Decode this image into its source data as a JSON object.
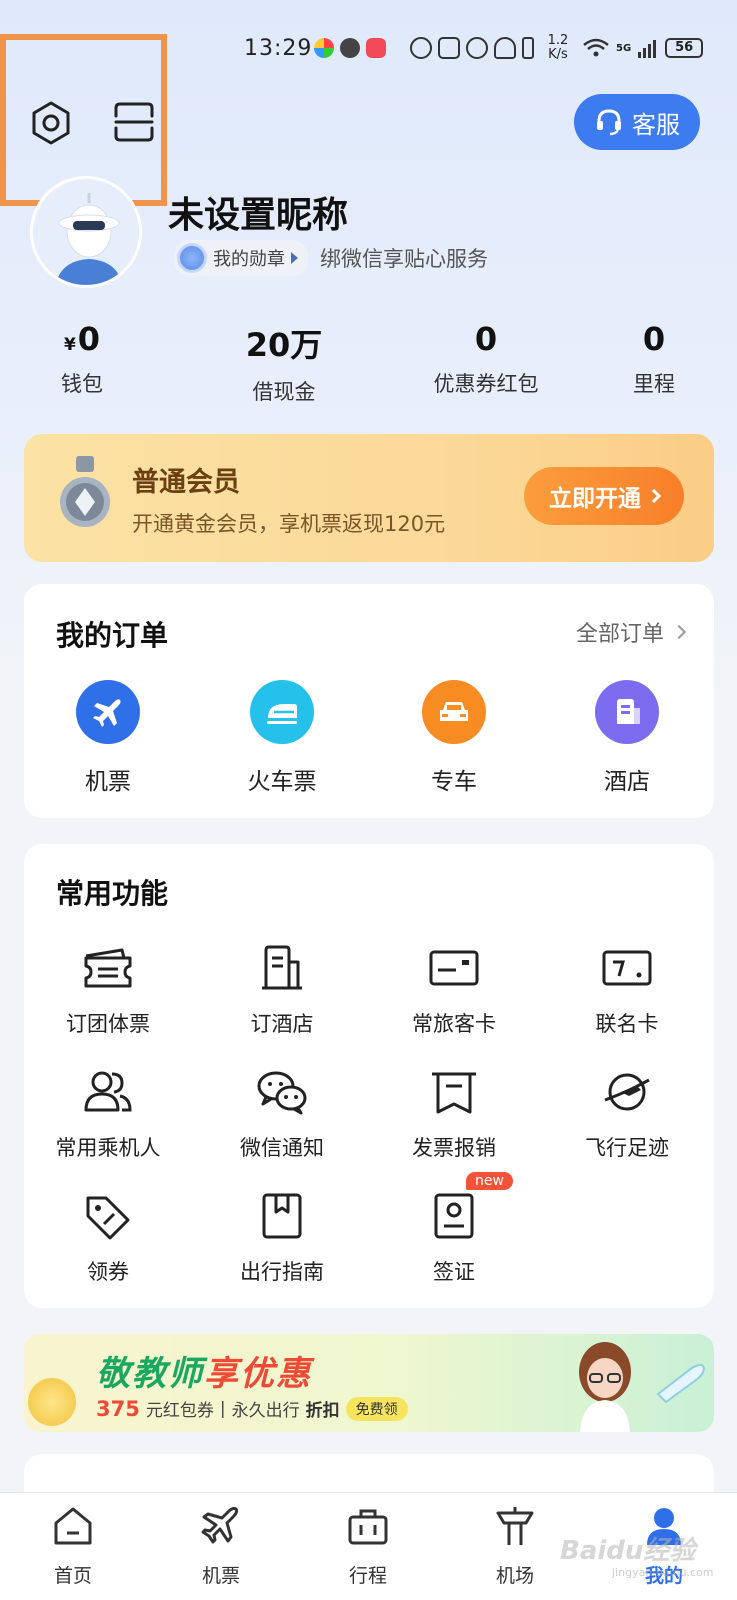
{
  "status_bar": {
    "time": "13:29",
    "speed_value": "1.2",
    "speed_unit": "K/s",
    "signal": "5G",
    "battery": "56"
  },
  "header": {
    "service_label": "客服"
  },
  "profile": {
    "nickname": "未设置昵称",
    "medal_label": "我的勋章",
    "wechat_tip": "绑微信享贴心服务"
  },
  "stats": [
    {
      "currency": "¥",
      "value": "0",
      "label": "钱包"
    },
    {
      "value": "20万",
      "label": "借现金"
    },
    {
      "value": "0",
      "label": "优惠券红包"
    },
    {
      "value": "0",
      "label": "里程"
    }
  ],
  "member": {
    "title": "普通会员",
    "desc": "开通黄金会员，享机票返现120元",
    "button": "立即开通"
  },
  "orders": {
    "title": "我的订单",
    "all_label": "全部订单",
    "items": [
      {
        "label": "机票",
        "icon": "plane-icon",
        "color": "#2f6fe8"
      },
      {
        "label": "火车票",
        "icon": "train-icon",
        "color": "#25c1ea"
      },
      {
        "label": "专车",
        "icon": "car-icon",
        "color": "#f78d22"
      },
      {
        "label": "酒店",
        "icon": "hotel-icon",
        "color": "#7b6cf0"
      }
    ]
  },
  "functions": {
    "title": "常用功能",
    "items": [
      {
        "label": "订团体票",
        "icon": "group-ticket-icon"
      },
      {
        "label": "订酒店",
        "icon": "hotel-building-icon"
      },
      {
        "label": "常旅客卡",
        "icon": "frequent-flyer-card-icon"
      },
      {
        "label": "联名卡",
        "icon": "co-branded-card-icon"
      },
      {
        "label": "常用乘机人",
        "icon": "passengers-icon"
      },
      {
        "label": "微信通知",
        "icon": "wechat-icon"
      },
      {
        "label": "发票报销",
        "icon": "invoice-icon"
      },
      {
        "label": "飞行足迹",
        "icon": "planet-plane-icon"
      },
      {
        "label": "领券",
        "icon": "coupon-tag-icon"
      },
      {
        "label": "出行指南",
        "icon": "guide-book-icon"
      },
      {
        "label": "签证",
        "icon": "visa-icon",
        "badge": "new"
      }
    ]
  },
  "promo": {
    "title_a": "敬教师",
    "title_b": "享优惠",
    "amount": "375",
    "sub_a": "元红包券",
    "sub_sep": "|",
    "sub_b": "永久出行",
    "sub_c": "折扣",
    "button": "免费领"
  },
  "bottom_nav": [
    {
      "label": "首页",
      "icon": "home-icon"
    },
    {
      "label": "机票",
      "icon": "plane-nav-icon"
    },
    {
      "label": "行程",
      "icon": "luggage-icon"
    },
    {
      "label": "机场",
      "icon": "airport-tower-icon"
    },
    {
      "label": "我的",
      "icon": "profile-icon",
      "active": true
    }
  ],
  "watermark": {
    "main": "Baidu经验",
    "sub": "jingyan.baidu.com"
  },
  "colors": {
    "accent_blue": "#3d7bf0",
    "highlight_orange": "#f0944b",
    "promo_red": "#ef4a35",
    "promo_green": "#1aa760"
  }
}
